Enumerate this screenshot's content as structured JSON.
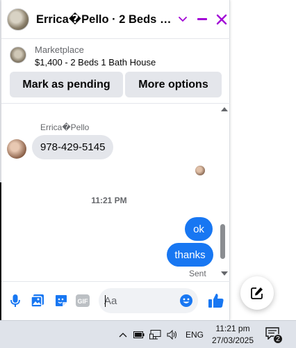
{
  "header": {
    "title": "Errica�Pello · 2 Beds 1 Bath House",
    "chevron_icon": "chevron-down-icon",
    "minimize_icon": "minimize-icon",
    "close_icon": "close-icon",
    "accent_color": "#a200d6"
  },
  "marketplace": {
    "label": "Marketplace",
    "item": "$1,400 - 2 Beds 1 Bath House",
    "mark_pending_label": "Mark as pending",
    "more_options_label": "More options"
  },
  "messages": {
    "sender_name": "Errica�Pello",
    "incoming": "978-429-5145",
    "timestamp": "11:21 PM",
    "outgoing": [
      "ok",
      "thanks"
    ],
    "status": "Sent",
    "bubble_color": "#1877f2"
  },
  "composer": {
    "placeholder": "Aa",
    "icons": [
      "microphone-icon",
      "photo-icon",
      "sticker-icon",
      "gif-icon",
      "emoji-icon",
      "thumbs-up-icon"
    ],
    "gif_label": "GIF"
  },
  "fab": {
    "icon": "compose-icon"
  },
  "taskbar": {
    "language": "ENG",
    "time": "11:21 pm",
    "date": "27/03/2025",
    "notification_count": "2"
  }
}
